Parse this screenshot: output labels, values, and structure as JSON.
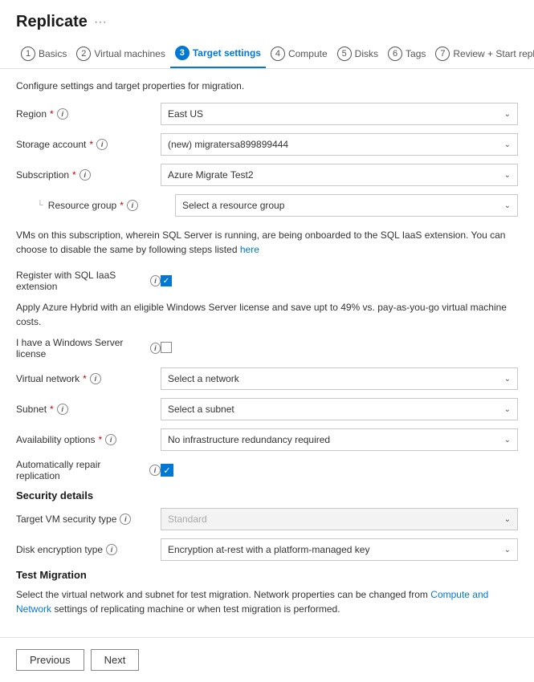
{
  "page": {
    "title": "Replicate",
    "ellipsis": "···"
  },
  "wizard": {
    "steps": [
      {
        "id": "basics",
        "num": "1",
        "label": "Basics",
        "active": false
      },
      {
        "id": "virtual-machines",
        "num": "2",
        "label": "Virtual machines",
        "active": false
      },
      {
        "id": "target-settings",
        "num": "3",
        "label": "Target settings",
        "active": true
      },
      {
        "id": "compute",
        "num": "4",
        "label": "Compute",
        "active": false
      },
      {
        "id": "disks",
        "num": "5",
        "label": "Disks",
        "active": false
      },
      {
        "id": "tags",
        "num": "6",
        "label": "Tags",
        "active": false
      },
      {
        "id": "review",
        "num": "7",
        "label": "Review + Start replication",
        "active": false
      }
    ]
  },
  "content": {
    "section_desc": "Configure settings and target properties for migration.",
    "fields": {
      "region": {
        "label": "Region",
        "required": true,
        "value": "East US"
      },
      "storage_account": {
        "label": "Storage account",
        "required": true,
        "value": "(new) migratersa899899444"
      },
      "subscription": {
        "label": "Subscription",
        "required": true,
        "value": "Azure Migrate Test2"
      },
      "resource_group": {
        "label": "Resource group",
        "required": true,
        "value": "Select a resource group"
      },
      "virtual_network": {
        "label": "Virtual network",
        "required": true,
        "value": "Select a network"
      },
      "subnet": {
        "label": "Subnet",
        "required": true,
        "value": "Select a subnet"
      },
      "availability_options": {
        "label": "Availability options",
        "required": true,
        "value": "No infrastructure redundancy required"
      },
      "auto_repair": {
        "label": "Automatically repair replication",
        "checked": true
      },
      "target_vm_security": {
        "label": "Target VM security type",
        "value": "Standard",
        "disabled": true
      },
      "disk_encryption": {
        "label": "Disk encryption type",
        "value": "Encryption at-rest with a platform-managed key"
      }
    },
    "sql_info": "VMs on this subscription, wherein SQL Server is running, are being onboarded to the SQL IaaS extension. You can choose to disable the same by following steps listed",
    "sql_link": "here",
    "register_sql_label": "Register with SQL IaaS extension",
    "hybrid_info": "Apply Azure Hybrid with an eligible Windows Server license and save upt to 49% vs. pay-as-you-go virtual machine costs.",
    "windows_license_label": "I have a Windows Server license",
    "security_title": "Security details",
    "test_migration_title": "Test Migration",
    "test_migration_desc_1": "Select the virtual network and subnet for test migration. Network properties can be changed from",
    "test_migration_link": "Compute and Network",
    "test_migration_desc_2": "settings of replicating machine or when test migration is performed."
  },
  "footer": {
    "previous_label": "Previous",
    "next_label": "Next"
  },
  "icons": {
    "info": "i",
    "chevron_down": "⌄"
  }
}
